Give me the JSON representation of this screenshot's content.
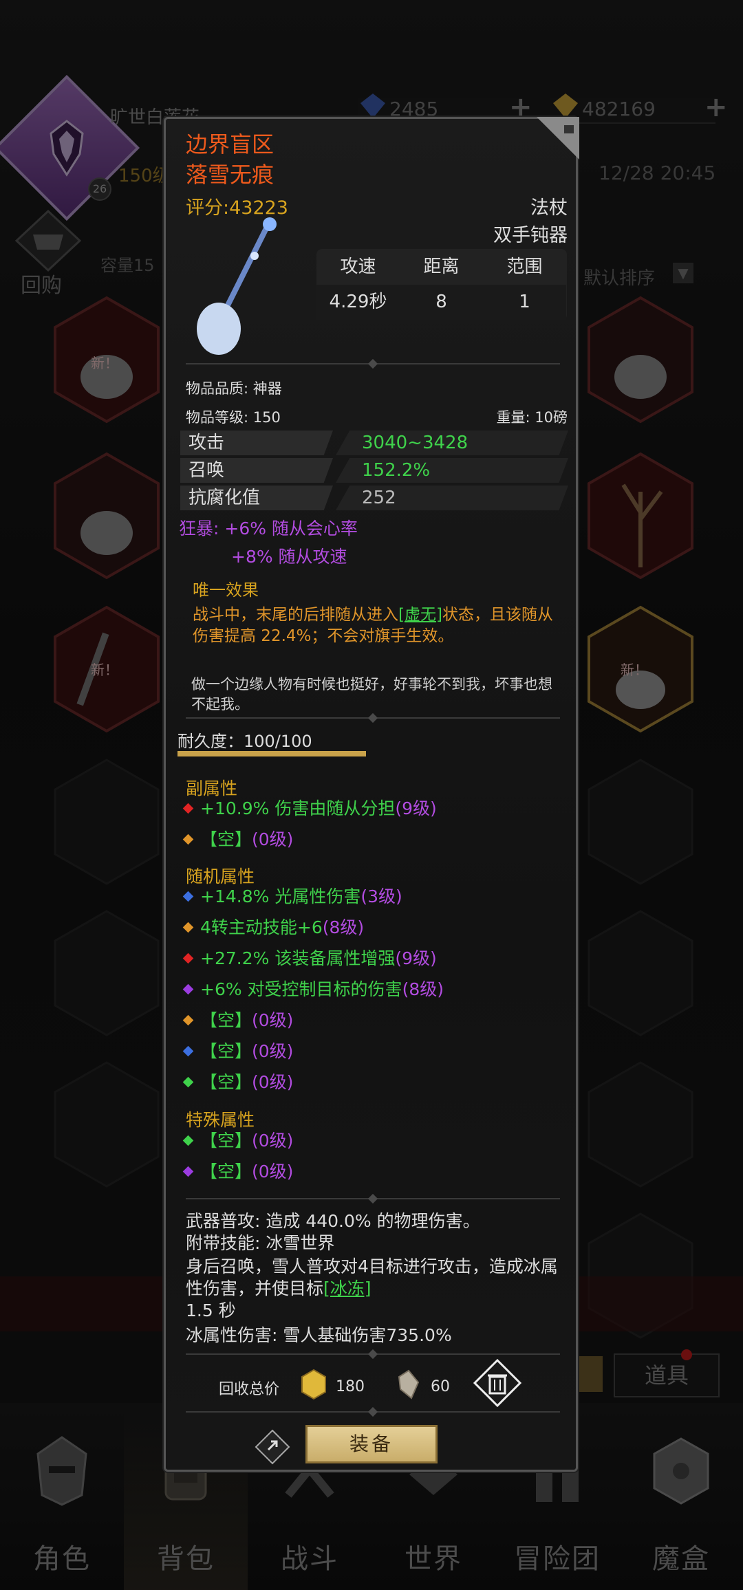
{
  "player": {
    "name": "旷世白莲花",
    "level_badge": "26",
    "level_text": "150级",
    "gems": "2485",
    "gold": "482169",
    "time": "12/28 20:45"
  },
  "inventory": {
    "buyback_label": "回购",
    "capacity_label": "容量15",
    "sort_label": "默认排序",
    "new_tag": "新！",
    "tool_button": "道具"
  },
  "nav": [
    {
      "label": "角色",
      "icon": "helmet-icon"
    },
    {
      "label": "背包",
      "icon": "backpack-icon"
    },
    {
      "label": "战斗",
      "icon": "swords-icon"
    },
    {
      "label": "世界",
      "icon": "world-icon"
    },
    {
      "label": "冒险团",
      "icon": "adventure-icon"
    },
    {
      "label": "魔盒",
      "icon": "magic-box-icon"
    }
  ],
  "item": {
    "name_line1": "边界盲区",
    "name_line2": "落雪无痕",
    "score": "评分:43223",
    "type": "法杖",
    "subtype": "双手钝器",
    "stats": {
      "headers": [
        "攻速",
        "距离",
        "范围"
      ],
      "values": [
        "4.29秒",
        "8",
        "1"
      ]
    },
    "quality": "物品品质: 神器",
    "level": "物品等级: 150",
    "weight": "重量: 10磅",
    "attributes": [
      {
        "label": "攻击",
        "value": "3040~3428"
      },
      {
        "label": "召唤",
        "value": "152.2%"
      },
      {
        "label": "抗腐化值",
        "value": "252"
      }
    ],
    "frenzy_line1": "狂暴: +6% 随从会心率",
    "frenzy_line2": "+8% 随从攻速",
    "unique_title": "唯一效果",
    "unique_desc_pre": "战斗中，末尾的后排随从进入",
    "unique_desc_link": "[虚无]",
    "unique_desc_post": "状态，且该随从伤害提高 22.4%；不会对旗手生效。",
    "flavor": "做一个边缘人物有时候也挺好，好事轮不到我，坏事也想不起我。",
    "durability": "耐久度：100/100",
    "durability_fraction": 1.0,
    "secondary_title": "副属性",
    "secondary": [
      {
        "gem": "#e02424",
        "text": "+10.9% 伤害由随从分担",
        "level": "(9级)"
      },
      {
        "gem": "#e0952a",
        "text": "【空】",
        "level": "(0级)"
      }
    ],
    "random_title": "随机属性",
    "random": [
      {
        "gem": "#3c6fe0",
        "text": "+14.8% 光属性伤害",
        "level": "(3级)"
      },
      {
        "gem": "#e0952a",
        "text": "4转主动技能+6",
        "level": "(8级)"
      },
      {
        "gem": "#e02424",
        "text": "+27.2% 该装备属性增强",
        "level": "(9级)"
      },
      {
        "gem": "#9b3ce0",
        "text": "+6% 对受控制目标的伤害",
        "level": "(8级)"
      },
      {
        "gem": "#e0952a",
        "text": "【空】",
        "level": "(0级)"
      },
      {
        "gem": "#3c6fe0",
        "text": "【空】",
        "level": "(0级)"
      },
      {
        "gem": "#3fd24b",
        "text": "【空】",
        "level": "(0级)"
      }
    ],
    "special_title": "特殊属性",
    "special": [
      {
        "gem": "#3fd24b",
        "text": "【空】",
        "level": "(0级)"
      },
      {
        "gem": "#9b3ce0",
        "text": "【空】",
        "level": "(0级)"
      }
    ],
    "skill_line1": "武器普攻: 造成 440.0% 的物理伤害。",
    "skill_line2": "附带技能: 冰雪世界",
    "skill_line3_pre": "身后召唤，雪人普攻对4目标进行攻击，造成冰属性伤害，并使目标",
    "skill_line3_link": "[冰冻]",
    "skill_line3_post": "1.5 秒",
    "skill_line4": "冰属性伤害: 雪人基础伤害735.0%",
    "recycle_label": "回收总价",
    "recycle_gold": "180",
    "recycle_shard": "60",
    "equip_label": "装备"
  },
  "colors": {
    "name": "#ef5a1c",
    "score": "#d7a31f",
    "green": "#3fd24b",
    "purple": "#b24ce0",
    "orange": "#e0952a"
  }
}
